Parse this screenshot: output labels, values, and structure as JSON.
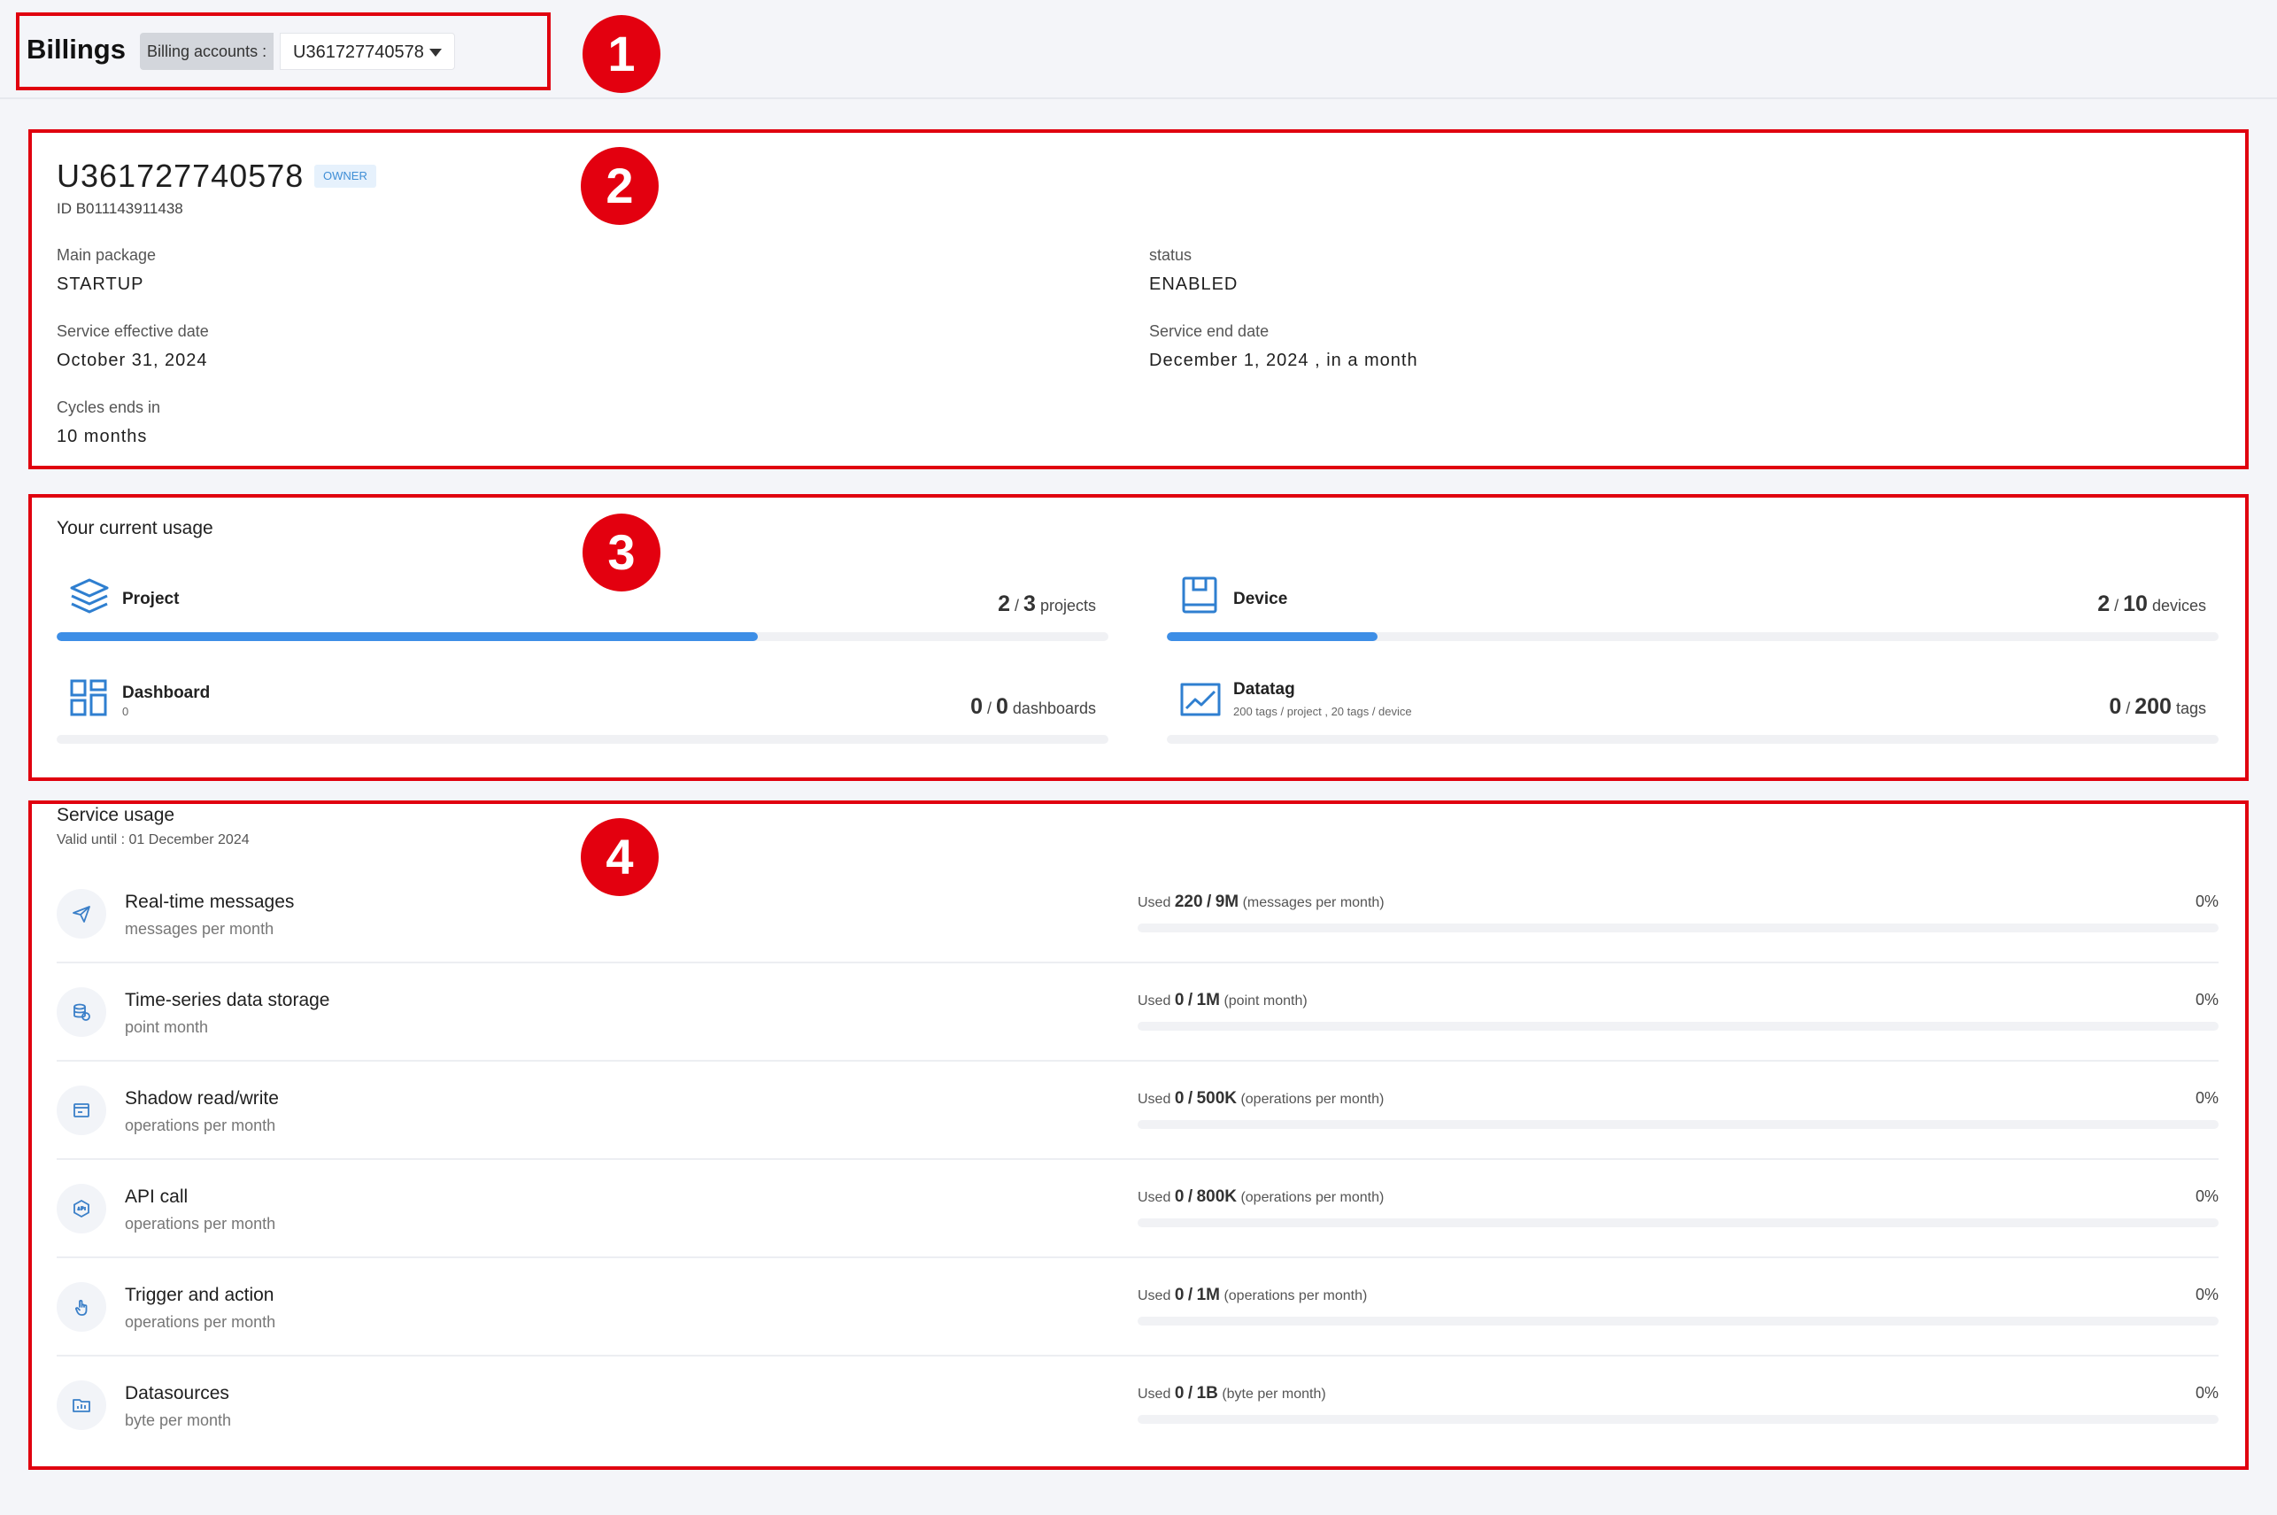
{
  "header": {
    "title": "Billings",
    "account_label": "Billing accounts :",
    "account_value": "U361727740578"
  },
  "annotations": [
    "1",
    "2",
    "3",
    "4"
  ],
  "account": {
    "name": "U361727740578",
    "role": "OWNER",
    "id": "ID B011143911438",
    "main_package": {
      "label": "Main package",
      "value": "STARTUP"
    },
    "status": {
      "label": "status",
      "value": "ENABLED"
    },
    "effective_date": {
      "label": "Service effective date",
      "value": "October 31, 2024"
    },
    "end_date": {
      "label": "Service end date",
      "value": "December 1, 2024 , in a month"
    },
    "cycles": {
      "label": "Cycles ends in",
      "value": "10 months"
    }
  },
  "current_usage": {
    "title": "Your current usage",
    "items": [
      {
        "name": "Project",
        "sub": "",
        "used": "2",
        "total": "3",
        "unit": "projects",
        "fraction": 0.667,
        "icon": "layers-icon"
      },
      {
        "name": "Device",
        "sub": "",
        "used": "2",
        "total": "10",
        "unit": "devices",
        "fraction": 0.2,
        "icon": "device-icon"
      },
      {
        "name": "Dashboard",
        "sub": "0",
        "used": "0",
        "total": "0",
        "unit": "dashboards",
        "fraction": 0,
        "icon": "dashboard-icon"
      },
      {
        "name": "Datatag",
        "sub": "200 tags / project , 20 tags / device",
        "used": "0",
        "total": "200",
        "unit": "tags",
        "fraction": 0,
        "icon": "chart-line-icon"
      }
    ]
  },
  "service_usage": {
    "title": "Service usage",
    "valid_until": "Valid until : 01 December 2024",
    "used_prefix": "Used",
    "items": [
      {
        "name": "Real-time messages",
        "sub": "messages per month",
        "used": "220",
        "total": "9M",
        "unit": "(messages per month)",
        "percent": "0%",
        "fraction": 0,
        "icon": "send-icon"
      },
      {
        "name": "Time-series data storage",
        "sub": "point month",
        "used": "0",
        "total": "1M",
        "unit": "(point month)",
        "percent": "0%",
        "fraction": 0,
        "icon": "database-icon"
      },
      {
        "name": "Shadow read/write",
        "sub": "operations per month",
        "used": "0",
        "total": "500K",
        "unit": "(operations per month)",
        "percent": "0%",
        "fraction": 0,
        "icon": "window-icon"
      },
      {
        "name": "API call",
        "sub": "operations per month",
        "used": "0",
        "total": "800K",
        "unit": "(operations per month)",
        "percent": "0%",
        "fraction": 0,
        "icon": "api-icon"
      },
      {
        "name": "Trigger and action",
        "sub": "operations per month",
        "used": "0",
        "total": "1M",
        "unit": "(operations per month)",
        "percent": "0%",
        "fraction": 0,
        "icon": "touch-icon"
      },
      {
        "name": "Datasources",
        "sub": "byte per month",
        "used": "0",
        "total": "1B",
        "unit": "(byte per month)",
        "percent": "0%",
        "fraction": 0,
        "icon": "folder-chart-icon"
      }
    ]
  },
  "colors": {
    "accent": "#3d8ee6",
    "annotation": "#e3000f",
    "owner_tag_bg": "#e6f1fc"
  }
}
